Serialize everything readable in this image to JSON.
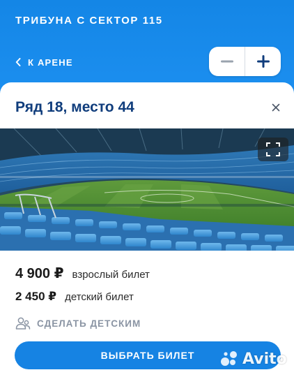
{
  "header": {
    "sector_title": "ТРИБУНА С СЕКТОР 115",
    "back_label": "К АРЕНЕ",
    "zoom_out_icon": "minus-icon",
    "zoom_in_icon": "plus-icon"
  },
  "seat_card": {
    "title": "Ряд 18, место 44",
    "close_icon": "close-icon",
    "photo": "stadium-seat-view",
    "fullscreen_icon": "fullscreen-icon",
    "prices": [
      {
        "amount": "4 900 ₽",
        "label": "взрослый билет"
      },
      {
        "amount": "2 450 ₽",
        "label": "детский билет"
      }
    ],
    "make_child_label": "СДЕЛАТЬ ДЕТСКИМ",
    "make_child_icon": "users-icon",
    "select_button_label": "ВЫБРАТЬ БИЛЕТ"
  },
  "watermark": {
    "text": "Avito"
  },
  "colors": {
    "header_blue": "#1a8be6",
    "title_navy": "#103d7c",
    "button_blue": "#1683e3",
    "muted_gray": "#8a94a3"
  }
}
